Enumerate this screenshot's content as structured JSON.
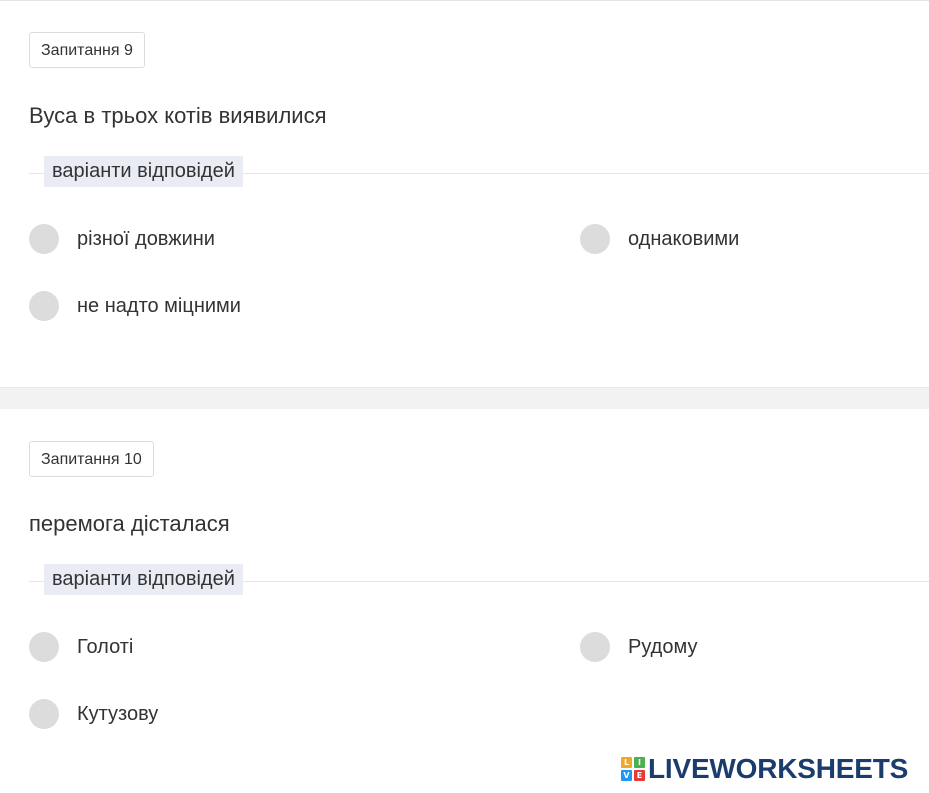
{
  "questions": [
    {
      "badge": "Запитання 9",
      "text": "Вуса в трьох котів виявилися",
      "legend": "варіанти відповідей",
      "options": [
        "різної довжини",
        "однаковими",
        "не надто міцними"
      ]
    },
    {
      "badge": "Запитання 10",
      "text": "перемога дісталася",
      "legend": "варіанти відповідей",
      "options": [
        "Голоті",
        "Рудому",
        "Кутузову"
      ]
    }
  ],
  "logo": {
    "blocks": [
      "L",
      "I",
      "V",
      "E"
    ],
    "text": "LIVEWORKSHEETS",
    "colors": [
      "#f5a623",
      "#4caf50",
      "#2196f3",
      "#e53935"
    ],
    "text_color": "#1b3d6e"
  }
}
